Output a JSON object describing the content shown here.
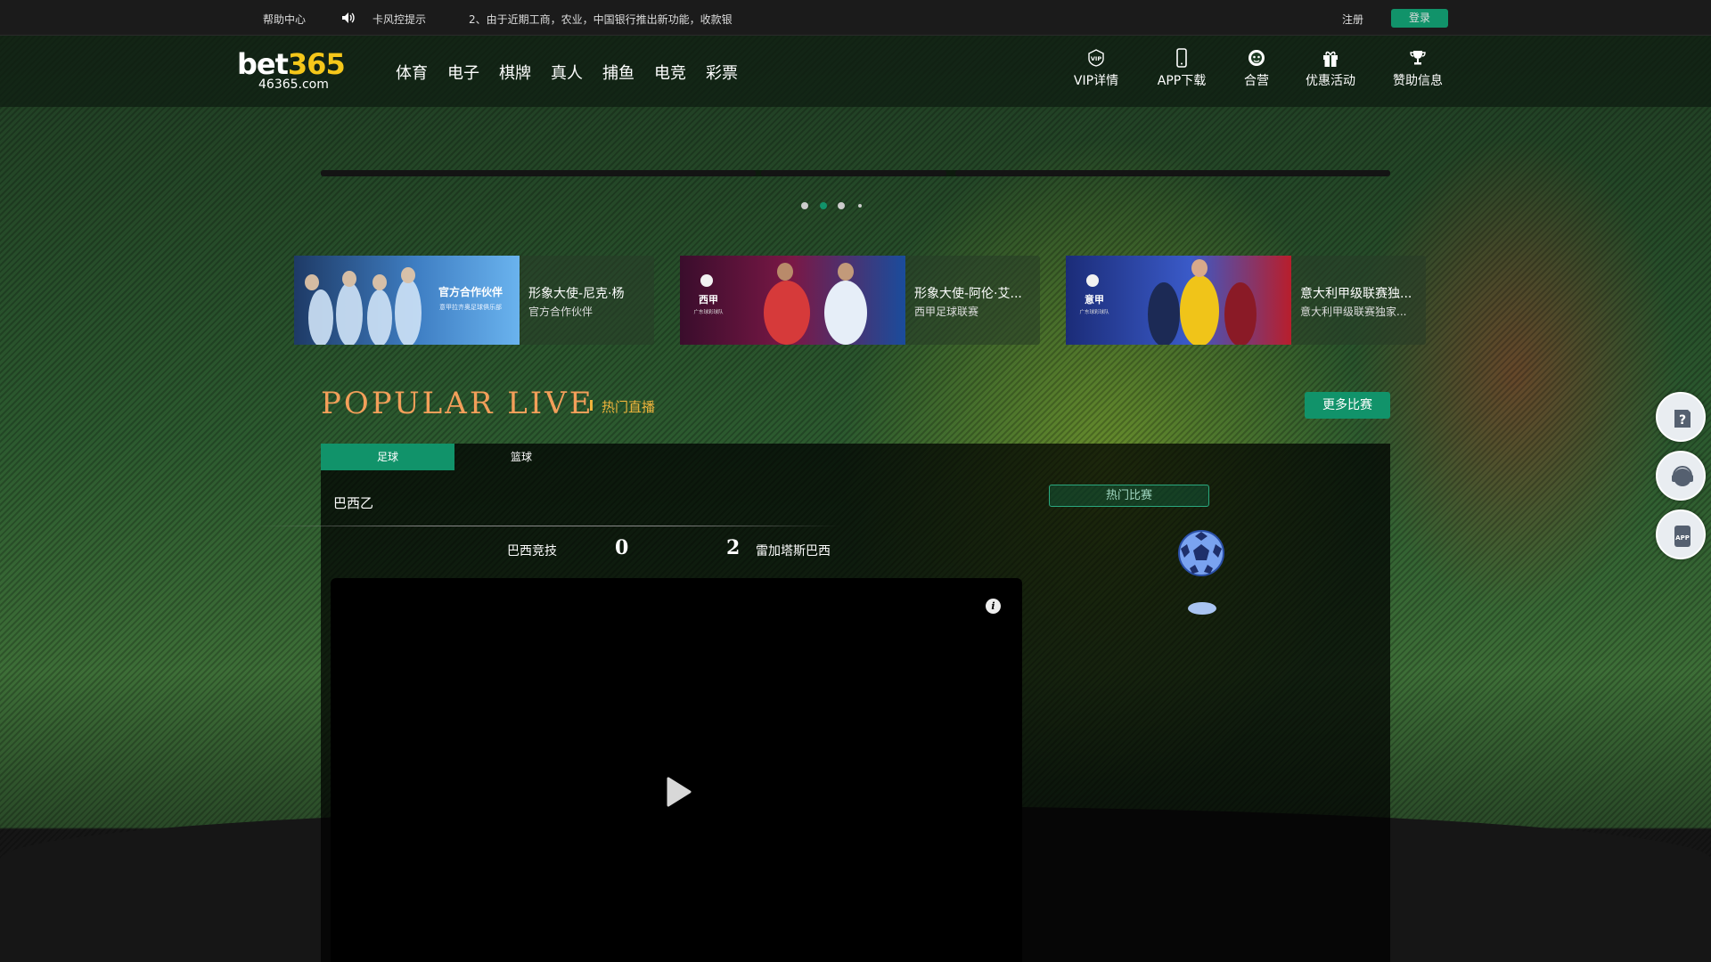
{
  "topbar": {
    "help": "帮助中心",
    "risk": "卡风控提示",
    "marquee": "2、由于近期工商，农业，中国银行推出新功能，收款银",
    "register": "注册",
    "login": "登录"
  },
  "header": {
    "logo_main_a": "bet",
    "logo_main_b": "365",
    "logo_sub": "46365.com",
    "nav": [
      "体育",
      "电子",
      "棋牌",
      "真人",
      "捕鱼",
      "电竞",
      "彩票"
    ],
    "quick_links": [
      {
        "label": "VIP详情",
        "icon": "vip-icon"
      },
      {
        "label": "APP下载",
        "icon": "phone-icon"
      },
      {
        "label": "合营",
        "icon": "agent-icon"
      },
      {
        "label": "优惠活动",
        "icon": "gift-icon"
      },
      {
        "label": "赞助信息",
        "icon": "trophy-icon"
      }
    ]
  },
  "banner": {
    "dots": 4,
    "active_dot": 1
  },
  "cards": [
    {
      "thumb_text": "官方合作伙伴",
      "thumb_sub": "意甲拉齐奥足球俱乐部",
      "title": "形象大使-尼克·杨",
      "sub": "官方合作伙伴",
      "color": "#3b82c4"
    },
    {
      "thumb_text": "西甲",
      "thumb_sub": "广东球彩球队",
      "title": "形象大使-阿伦·艾...",
      "sub": "西甲足球联赛",
      "color": "#6d1a4a"
    },
    {
      "thumb_text": "意甲",
      "thumb_sub": "广东球彩球队",
      "title": "意大利甲级联赛独...",
      "sub": "意大利甲级联赛独家...",
      "color": "#2d3c8c"
    }
  ],
  "popular": {
    "title": "POPULAR LIVE",
    "subtitle": "热门直播",
    "more": "更多比赛",
    "tabs": [
      "足球",
      "篮球"
    ],
    "match": {
      "league": "巴西乙",
      "home": "巴西竞技",
      "home_score": "0",
      "away_score": "2",
      "away": "雷加塔斯巴西"
    },
    "info_glyph": "i",
    "hot_button": "热门比赛"
  },
  "colors": {
    "accent": "#11936a",
    "title_orange": "#f39f5a",
    "gold": "#f0b43c"
  },
  "side_buttons": [
    "help-icon",
    "customer-service-icon",
    "app-download-icon"
  ]
}
